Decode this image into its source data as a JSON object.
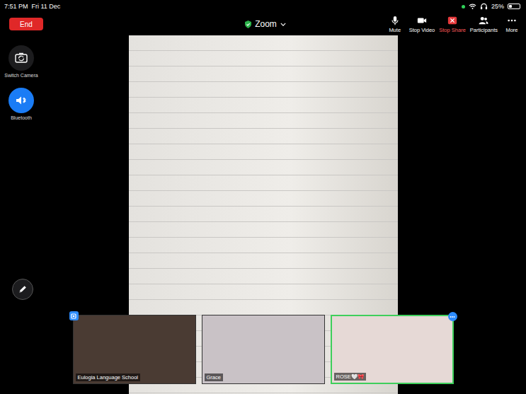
{
  "status_bar": {
    "time": "7:51 PM",
    "date": "Fri 11 Dec",
    "battery": "25%",
    "battery_level": 0.25
  },
  "toolbar": {
    "end_button": "End",
    "title": "Zoom",
    "actions": [
      {
        "label": "Mute",
        "kind": "mic"
      },
      {
        "label": "Stop Video",
        "kind": "video"
      },
      {
        "label": "Stop Share",
        "kind": "share"
      },
      {
        "label": "Participants",
        "kind": "participants"
      },
      {
        "label": "More",
        "kind": "more"
      }
    ]
  },
  "side_controls": [
    {
      "label": "Switch Camera",
      "kind": "camera",
      "active": false
    },
    {
      "label": "Bluetooth",
      "kind": "bluetooth",
      "active": true
    }
  ],
  "participants": [
    {
      "name": "Eulogia Language School",
      "speaking": false,
      "badge": "pin"
    },
    {
      "name": "Grace",
      "speaking": false,
      "badge": "none"
    },
    {
      "name": "ROSE🤍🎀",
      "speaking": true,
      "badge": "menu"
    }
  ]
}
